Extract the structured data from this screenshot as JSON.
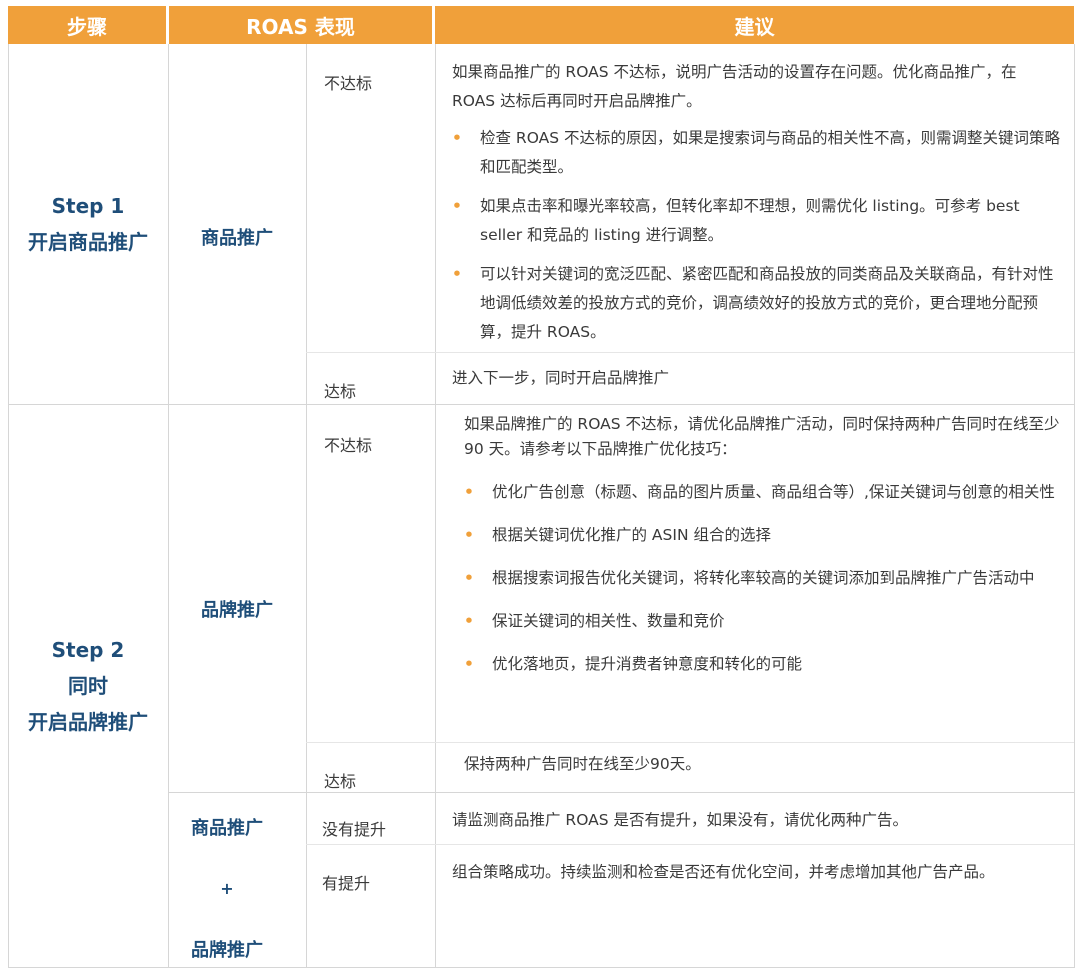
{
  "header": {
    "col_step": "步骤",
    "col_roas": "ROAS 表现",
    "col_advice": "建议"
  },
  "step1": {
    "label_line1": "Step 1",
    "label_line2": "开启商品推广",
    "ad_type": "商品推广",
    "fail": {
      "status": "不达标",
      "intro": "如果商品推广的 ROAS 不达标，说明广告活动的设置存在问题。优化商品推广，在 ROAS 达标后再同时开启品牌推广。",
      "bullets": [
        "检查 ROAS 不达标的原因，如果是搜索词与商品的相关性不高，则需调整关键词策略和匹配类型。",
        "如果点击率和曝光率较高，但转化率却不理想，则需优化 listing。可参考 best seller 和竞品的 listing 进行调整。",
        "可以针对关键词的宽泛匹配、紧密匹配和商品投放的同类商品及关联商品，有针对性地调低绩效差的投放方式的竞价，调高绩效好的投放方式的竞价，更合理地分配预算，提升 ROAS。"
      ]
    },
    "pass": {
      "status": "达标",
      "advice": "进入下一步，同时开启品牌推广"
    }
  },
  "step2": {
    "label_line1": "Step 2",
    "label_line2": "同时",
    "label_line3": "开启品牌推广",
    "ad_type": "品牌推广",
    "fail": {
      "status": "不达标",
      "intro": "如果品牌推广的 ROAS 不达标，请优化品牌推广活动，同时保持两种广告同时在线至少 90 天。请参考以下品牌推广优化技巧：",
      "bullets": [
        "优化广告创意（标题、商品的图片质量、商品组合等）,保证关键词与创意的相关性",
        "根据关键词优化推广的 ASIN 组合的选择",
        "根据搜索词报告优化关键词，将转化率较高的关键词添加到品牌推广广告活动中",
        "保证关键词的相关性、数量和竞价",
        "优化落地页，提升消费者钟意度和转化的可能"
      ]
    },
    "pass": {
      "status": "达标",
      "advice": "保持两种广告同时在线至少90天。"
    },
    "combo": {
      "line1": "商品推广",
      "plus": "+",
      "line2": "品牌推广",
      "no_improve": {
        "status": "没有提升",
        "advice": "请监测商品推广 ROAS 是否有提升，如果没有，请优化两种广告。"
      },
      "improve": {
        "status": "有提升",
        "advice": "组合策略成功。持续监测和检查是否还有优化空间，并考虑增加其他广告产品。"
      }
    }
  },
  "colors": {
    "header_bg": "#f0a03a",
    "header_text": "#ffffff",
    "label_text": "#1f4e79",
    "bullet": "#f0a03a"
  }
}
